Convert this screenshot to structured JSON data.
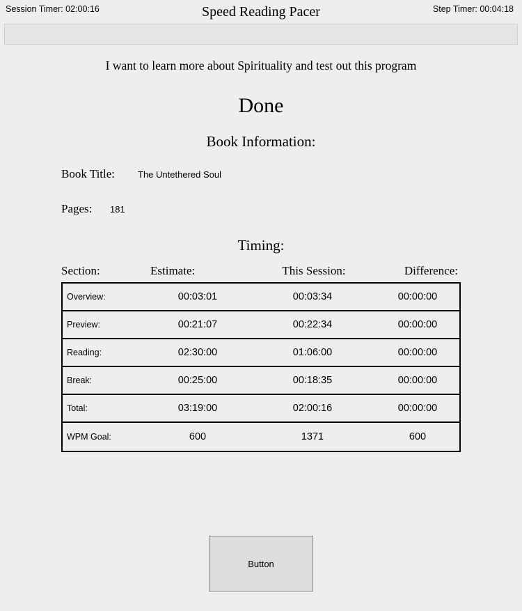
{
  "header": {
    "session_timer_label": "Session Timer:",
    "session_timer_value": "02:00:16",
    "step_timer_label": "Step Timer:",
    "step_timer_value": "00:04:18",
    "app_title": "Speed Reading Pacer"
  },
  "purpose": "I want to learn more about Spirituality and test out this program",
  "done_label": "Done",
  "book_info_heading": "Book Information:",
  "book": {
    "title_label": "Book Title:",
    "title_value": "The Untethered Soul",
    "pages_label": "Pages:",
    "pages_value": "181"
  },
  "timing_heading": "Timing:",
  "timing_columns": {
    "section": "Section:",
    "estimate": "Estimate:",
    "session": "This Session:",
    "difference": "Difference:"
  },
  "timing_rows": [
    {
      "section": "Overview:",
      "estimate": "00:03:01",
      "session": "00:03:34",
      "difference": "00:00:00"
    },
    {
      "section": "Preview:",
      "estimate": "00:21:07",
      "session": "00:22:34",
      "difference": "00:00:00"
    },
    {
      "section": "Reading:",
      "estimate": "02:30:00",
      "session": "01:06:00",
      "difference": "00:00:00"
    },
    {
      "section": "Break:",
      "estimate": "00:25:00",
      "session": "00:18:35",
      "difference": "00:00:00"
    },
    {
      "section": "Total:",
      "estimate": "03:19:00",
      "session": "02:00:16",
      "difference": "00:00:00"
    },
    {
      "section": "WPM Goal:",
      "estimate": "600",
      "session": "1371",
      "difference": "600"
    }
  ],
  "button_label": "Button"
}
